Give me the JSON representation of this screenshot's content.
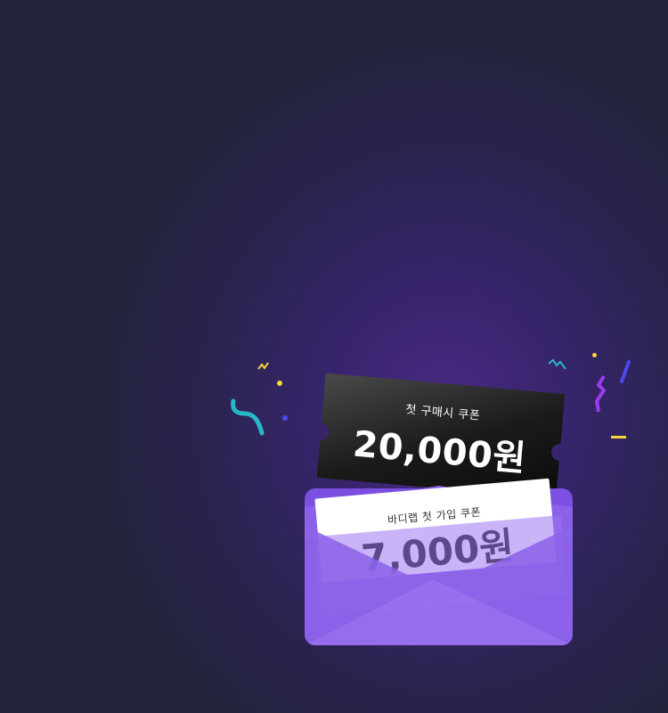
{
  "coupons": {
    "first_purchase": {
      "label": "첫 구매시 쿠폰",
      "amount": "20,000원"
    },
    "signup": {
      "label": "바디랩 첫 가입 쿠폰",
      "amount": "7,000원"
    }
  },
  "colors": {
    "background": "#22243a",
    "glow": "#4a2a86",
    "envelope": "#7b4fe0",
    "coupon_dark": "#111111",
    "coupon_light": "#ffffff",
    "confetti_yellow": "#f5d83a",
    "confetti_teal": "#26b7c9",
    "confetti_purple": "#9a3cf0",
    "confetti_blue": "#4b4af0"
  }
}
